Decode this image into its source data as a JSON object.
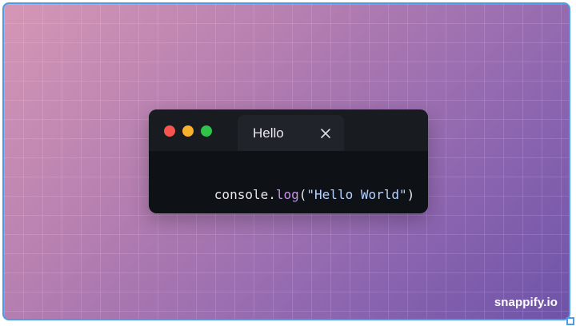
{
  "canvas": {
    "watermark": "snappify.io"
  },
  "window": {
    "controls": {
      "close_color": "#f6544e",
      "minimize_color": "#f8b12c",
      "maximize_color": "#2fc34a"
    },
    "tabs": [
      {
        "label": "Hello",
        "icon": "close-icon"
      }
    ],
    "code": {
      "language": "javascript",
      "tokens": [
        {
          "text": "console.",
          "type": "plain"
        },
        {
          "text": "log",
          "type": "function"
        },
        {
          "text": "(",
          "type": "plain"
        },
        {
          "text": "\"Hello World\"",
          "type": "string"
        },
        {
          "text": ")",
          "type": "plain"
        }
      ]
    }
  }
}
